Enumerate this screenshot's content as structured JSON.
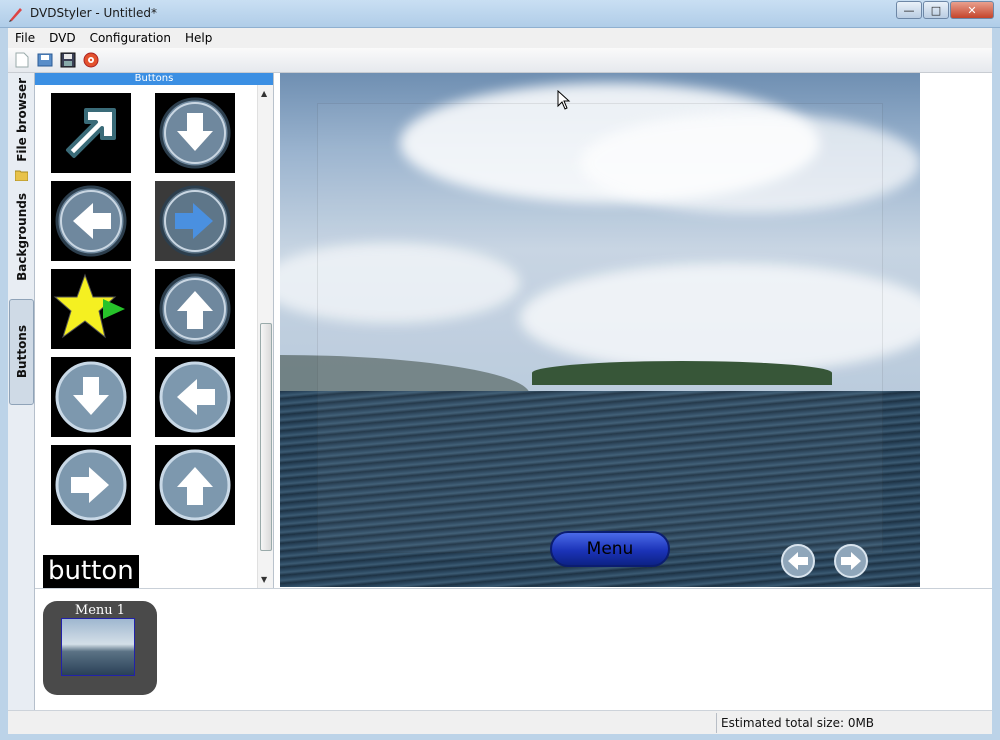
{
  "window": {
    "title": "DVDStyler - Untitled*"
  },
  "menubar": [
    "File",
    "DVD",
    "Configuration",
    "Help"
  ],
  "toolbar": {
    "icons": [
      "new-file-icon",
      "open-icon",
      "save-icon",
      "burn-icon"
    ]
  },
  "left_tabs": [
    {
      "label": "File browser",
      "active": false
    },
    {
      "label": "Backgrounds",
      "active": false
    },
    {
      "label": "Buttons",
      "active": true
    }
  ],
  "buttons_panel": {
    "header": "Buttons",
    "items": [
      "arrow-up-right-icon",
      "arrow-down-icon",
      "arrow-left-icon",
      "arrow-right-icon",
      "star-play-icon",
      "arrow-up-icon",
      "arrow-down-icon",
      "arrow-left-icon",
      "arrow-right-icon",
      "arrow-up-icon"
    ],
    "text_sample": "button"
  },
  "preview": {
    "menu_button_label": "Menu"
  },
  "menus": [
    {
      "label": "Menu 1"
    }
  ],
  "status": {
    "text": "Estimated total size: 0MB"
  },
  "colors": {
    "accent": "#3b8fe3",
    "menu_button": "#1b33b8"
  }
}
